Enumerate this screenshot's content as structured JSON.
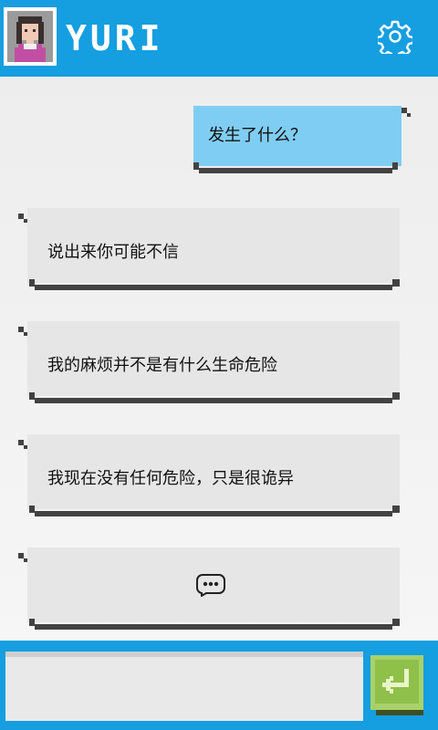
{
  "header": {
    "title": "YURI",
    "avatar_icon": "pixel-girl-avatar-icon",
    "settings_icon": "gear-icon",
    "background": "#159ee0"
  },
  "messages": [
    {
      "side": "right",
      "text": "发生了什么？"
    },
    {
      "side": "left",
      "text": "说出来你可能不信"
    },
    {
      "side": "left",
      "text": "我的麻烦并不是有什么生命危险"
    },
    {
      "side": "left",
      "text": "我现在没有任何危险，只是很诡异"
    },
    {
      "side": "left",
      "typing_icon": "typing-dots-icon"
    }
  ],
  "input": {
    "value": "",
    "placeholder": ""
  },
  "send_icon": "enter-arrow-icon",
  "colors": {
    "accent": "#159ee0",
    "user_bubble": "#80cdf4",
    "partner_bubble": "#e6e6e6",
    "send_button": "#a9d16a"
  }
}
